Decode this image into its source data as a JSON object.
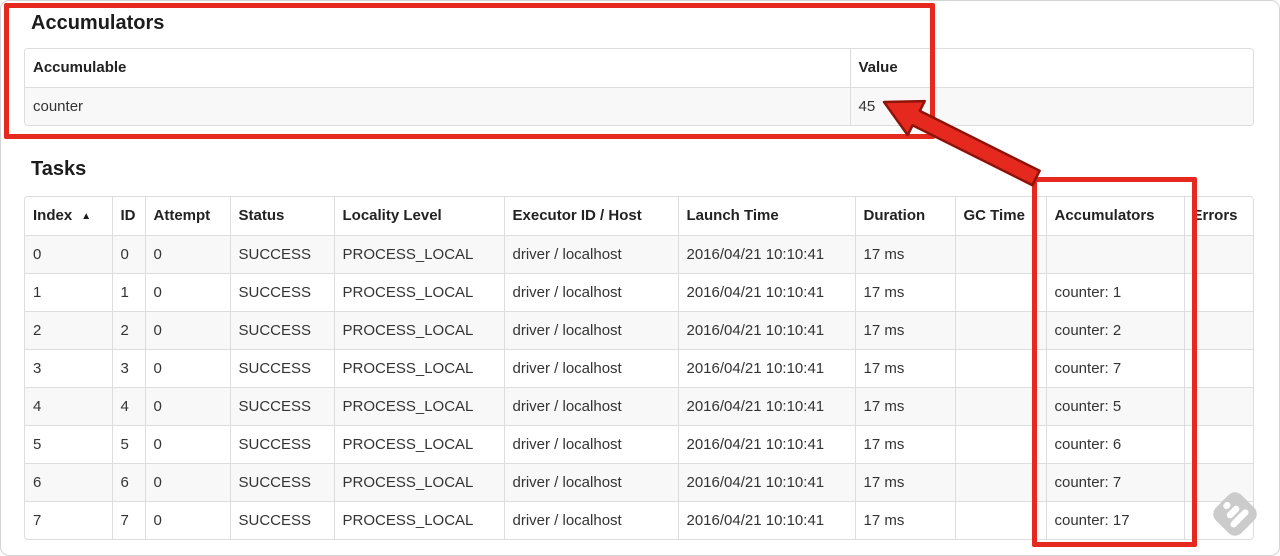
{
  "annotation": {
    "color": "#e6291f",
    "arrow_outline": "#8e1309"
  },
  "accumulators_section": {
    "title": "Accumulators",
    "table": {
      "headers": {
        "accumulable": "Accumulable",
        "value": "Value"
      },
      "rows": [
        {
          "accumulable": "counter",
          "value": "45"
        }
      ]
    }
  },
  "tasks_section": {
    "title": "Tasks",
    "table": {
      "headers": [
        "Index",
        "ID",
        "Attempt",
        "Status",
        "Locality Level",
        "Executor ID / Host",
        "Launch Time",
        "Duration",
        "GC Time",
        "Accumulators",
        "Errors"
      ],
      "sort_indicator": "▲",
      "rows": [
        [
          "0",
          "0",
          "0",
          "SUCCESS",
          "PROCESS_LOCAL",
          "driver / localhost",
          "2016/04/21 10:10:41",
          "17 ms",
          "",
          "",
          ""
        ],
        [
          "1",
          "1",
          "0",
          "SUCCESS",
          "PROCESS_LOCAL",
          "driver / localhost",
          "2016/04/21 10:10:41",
          "17 ms",
          "",
          "counter: 1",
          ""
        ],
        [
          "2",
          "2",
          "0",
          "SUCCESS",
          "PROCESS_LOCAL",
          "driver / localhost",
          "2016/04/21 10:10:41",
          "17 ms",
          "",
          "counter: 2",
          ""
        ],
        [
          "3",
          "3",
          "0",
          "SUCCESS",
          "PROCESS_LOCAL",
          "driver / localhost",
          "2016/04/21 10:10:41",
          "17 ms",
          "",
          "counter: 7",
          ""
        ],
        [
          "4",
          "4",
          "0",
          "SUCCESS",
          "PROCESS_LOCAL",
          "driver / localhost",
          "2016/04/21 10:10:41",
          "17 ms",
          "",
          "counter: 5",
          ""
        ],
        [
          "5",
          "5",
          "0",
          "SUCCESS",
          "PROCESS_LOCAL",
          "driver / localhost",
          "2016/04/21 10:10:41",
          "17 ms",
          "",
          "counter: 6",
          ""
        ],
        [
          "6",
          "6",
          "0",
          "SUCCESS",
          "PROCESS_LOCAL",
          "driver / localhost",
          "2016/04/21 10:10:41",
          "17 ms",
          "",
          "counter: 7",
          ""
        ],
        [
          "7",
          "7",
          "0",
          "SUCCESS",
          "PROCESS_LOCAL",
          "driver / localhost",
          "2016/04/21 10:10:41",
          "17 ms",
          "",
          "counter: 17",
          ""
        ]
      ]
    }
  },
  "watermark": {
    "icon": "skitch-watermark-icon"
  }
}
